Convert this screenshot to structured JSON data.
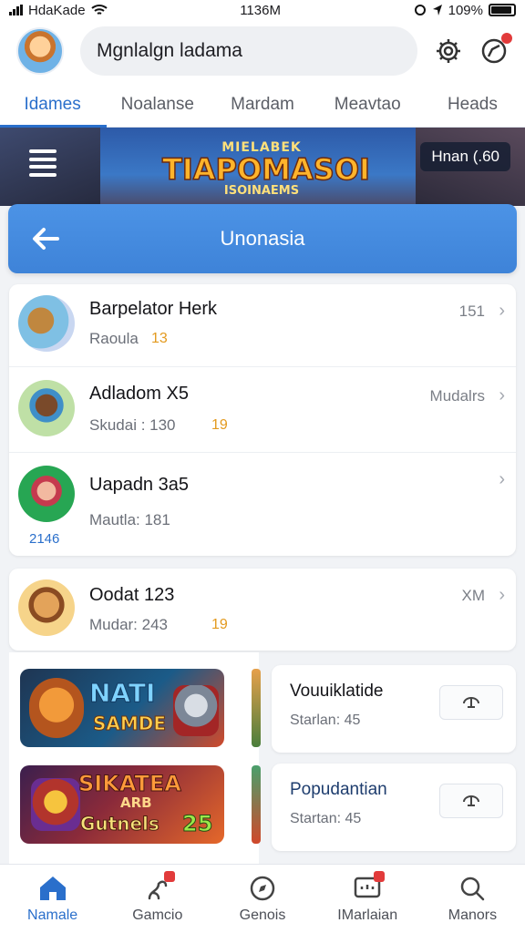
{
  "status": {
    "carrier": "HdaKade",
    "time": "1136M",
    "battery": "109%"
  },
  "header": {
    "search_text": "Mgnlalgn ladama"
  },
  "tabs": [
    {
      "label": "Idames"
    },
    {
      "label": "Noalanse"
    },
    {
      "label": "Mardam"
    },
    {
      "label": "Meavtao"
    },
    {
      "label": "Heads"
    }
  ],
  "banner": {
    "logo_top": "MIELABEK",
    "logo_main": "TIAPOMASOI",
    "logo_bottom": "ISOINAEMS",
    "pill": "Hnan (.60"
  },
  "nav": {
    "title": "Unonasia"
  },
  "list": [
    {
      "title": "Barpelator Herk",
      "sub": "Raoula",
      "sub_num": "13",
      "meta": "151"
    },
    {
      "title": "Adladom X5",
      "sub": "Skudai : 130",
      "sub_num": "19",
      "meta": "Mudalrs"
    },
    {
      "title": "Uapadn 3a5",
      "sub": "Mautla: 181",
      "sub_num": "",
      "meta": "",
      "avatar_badge": "2146"
    },
    {
      "title": "Oodat 123",
      "sub": "Mudar: 243",
      "sub_num": "19",
      "meta": "XM"
    }
  ],
  "games": [
    {
      "line1": "NATI",
      "line2": "SAMDE"
    },
    {
      "line1": "SIKATEA",
      "line2": "ARB",
      "line3": "Gutnels",
      "num": "25"
    }
  ],
  "side_cards": [
    {
      "title": "Vouuiklatide",
      "sub": "Starlan: 45"
    },
    {
      "title": "Popudantian",
      "sub": "Startan: 45"
    }
  ],
  "bottom_nav": [
    {
      "label": "Namale"
    },
    {
      "label": "Gamcio"
    },
    {
      "label": "Genois"
    },
    {
      "label": "IMarlaian"
    },
    {
      "label": "Manors"
    }
  ],
  "colors": {
    "accent": "#2a6fcb",
    "nav_card": "#4189dc",
    "badge": "#e23b3b",
    "highlight_number": "#e39a1f"
  }
}
